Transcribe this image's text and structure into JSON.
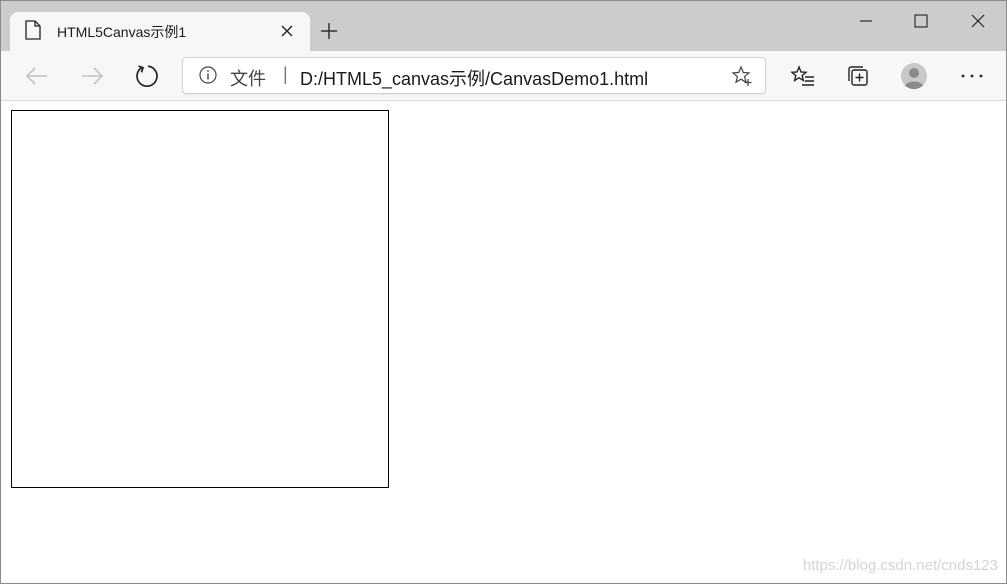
{
  "tab": {
    "title": "HTML5Canvas示例1",
    "page_icon": "page-icon",
    "close_icon": "close-icon"
  },
  "tabstrip": {
    "new_tab_icon": "plus-icon"
  },
  "window_controls": {
    "minimize_icon": "minimize-icon",
    "maximize_icon": "maximize-icon",
    "close_icon": "close-icon"
  },
  "toolbar": {
    "back_icon": "back-arrow-icon",
    "forward_icon": "forward-arrow-icon",
    "refresh_icon": "refresh-icon",
    "favorites_icon": "favorites-list-icon",
    "collections_icon": "collections-icon",
    "profile_icon": "profile-avatar-icon",
    "more_icon": "more-icon"
  },
  "address_bar": {
    "security_label": "文件",
    "separator": "|",
    "url": "D:/HTML5_canvas示例/CanvasDemo1.html",
    "info_icon": "info-icon",
    "favorite_icon": "star-plus-icon"
  },
  "page": {
    "watermark": "https://blog.csdn.net/cnds123"
  },
  "colors": {
    "tabstrip_bg": "#cccccc",
    "toolbar_bg": "#f7f7f7",
    "canvas_border": "#000000"
  }
}
